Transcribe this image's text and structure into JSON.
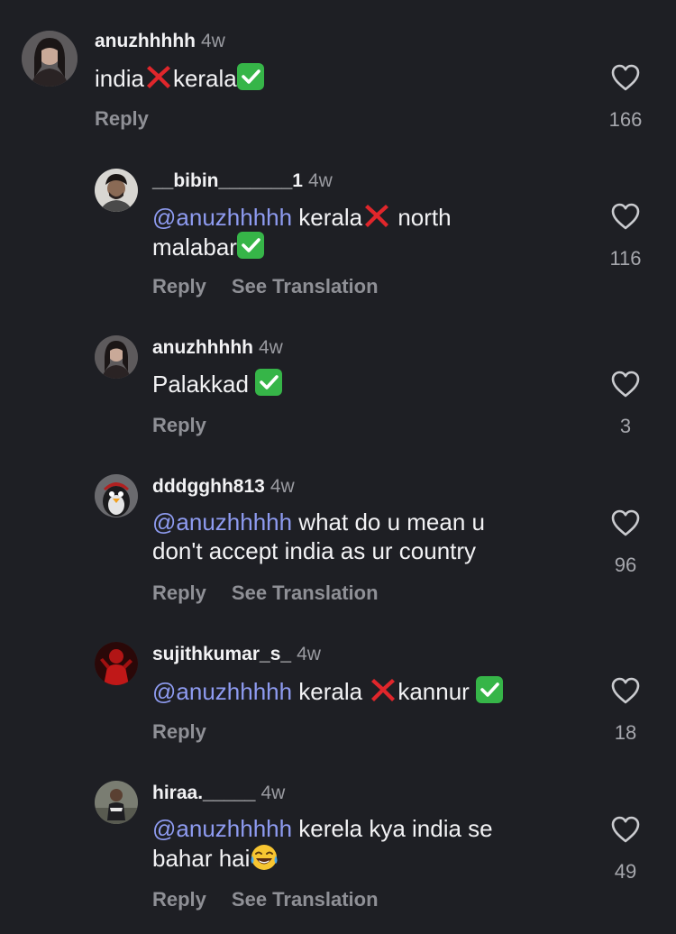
{
  "comments": [
    {
      "user": "anuzhhhhh",
      "time": "4w",
      "text_parts": [
        "india",
        "kerala"
      ],
      "reply": "Reply",
      "likes": "166"
    },
    {
      "user": "__bibin_______1",
      "time": "4w",
      "mention": "@anuzhhhhh",
      "text_parts": [
        " kerala",
        " north",
        "malabar"
      ],
      "reply": "Reply",
      "translate": "See Translation",
      "likes": "116"
    },
    {
      "user": "anuzhhhhh",
      "time": "4w",
      "text_parts": [
        "Palakkad "
      ],
      "reply": "Reply",
      "likes": "3"
    },
    {
      "user": "dddgghh813",
      "time": "4w",
      "mention": "@anuzhhhhh",
      "text_parts": [
        " what do u mean u",
        "don't accept india as ur country"
      ],
      "reply": "Reply",
      "translate": "See Translation",
      "likes": "96"
    },
    {
      "user": "sujithkumar_s_",
      "time": "4w",
      "mention": "@anuzhhhhh",
      "text_parts": [
        " kerala ",
        "kannur "
      ],
      "reply": "Reply",
      "likes": "18"
    },
    {
      "user": "hiraa._____",
      "time": "4w",
      "mention": "@anuzhhhhh",
      "text_parts": [
        " kerela kya india se",
        "bahar hai"
      ],
      "reply": "Reply",
      "translate": "See Translation",
      "likes": "49"
    }
  ],
  "icons": {
    "like": "heart-outline-icon",
    "check": "check-mark-button-emoji",
    "cross": "cross-mark-emoji",
    "laugh": "tears-of-joy-emoji"
  },
  "colors": {
    "background": "#1e1f24",
    "mention": "#8e9bf0",
    "muted": "#8f9096",
    "check": "#36b548",
    "cross": "#e0262b"
  }
}
